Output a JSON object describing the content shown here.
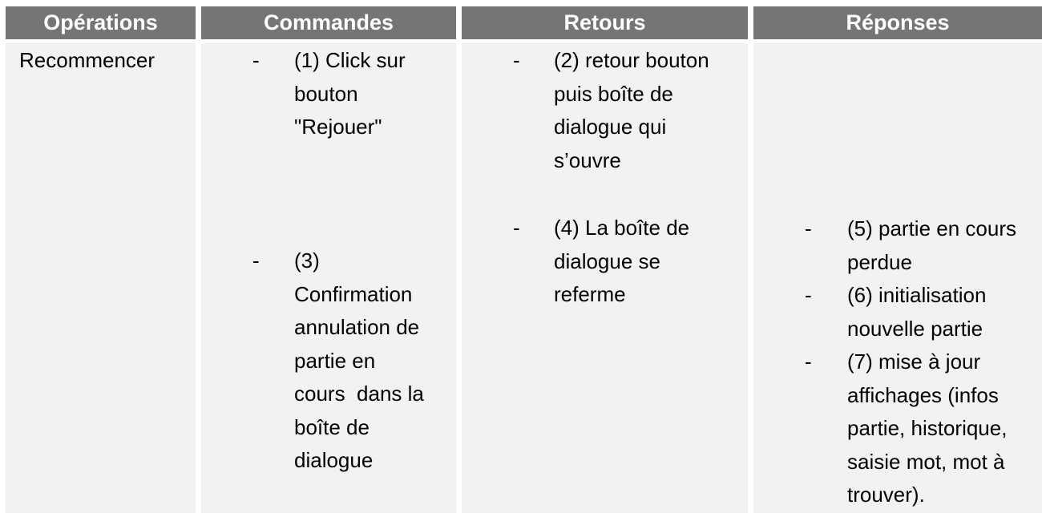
{
  "headers": [
    "Opérations",
    "Commandes",
    "Retours",
    "Réponses"
  ],
  "operation": "Recommencer",
  "bullet": "-",
  "commandes": [
    {
      "lines": [
        "(1) Click sur",
        "bouton",
        "\"Rejouer\""
      ]
    },
    {
      "lines": [
        "(3)",
        "Confirmation",
        "annulation de",
        "partie en",
        "cours  dans la",
        "boîte de",
        "dialogue"
      ]
    }
  ],
  "retours": [
    {
      "lines": [
        "(2) retour bouton",
        "puis boîte de",
        "dialogue qui",
        "s’ouvre"
      ]
    },
    {
      "lines": [
        "(4) La boîte de",
        "dialogue se",
        "referme"
      ]
    }
  ],
  "reponses": [
    {
      "lines": [
        "(5) partie en cours",
        "perdue"
      ]
    },
    {
      "lines": [
        "(6) initialisation",
        "nouvelle partie"
      ]
    },
    {
      "lines": [
        "(7) mise à jour",
        "affichages (infos",
        "partie, historique,",
        "saisie mot, mot à",
        "trouver)."
      ]
    }
  ]
}
